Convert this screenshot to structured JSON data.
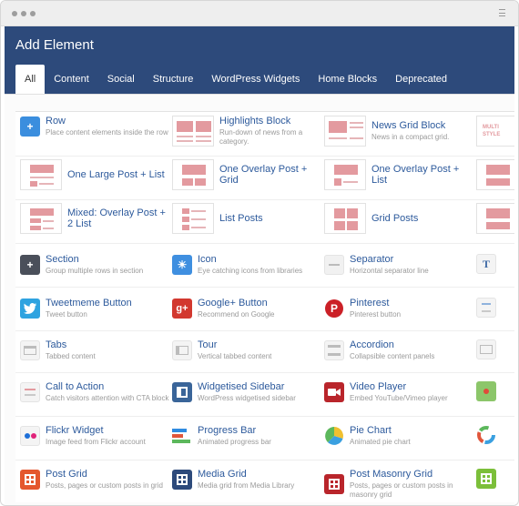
{
  "header": {
    "title": "Add Element"
  },
  "tabs": [
    {
      "label": "All",
      "active": true
    },
    {
      "label": "Content"
    },
    {
      "label": "Social"
    },
    {
      "label": "Structure"
    },
    {
      "label": "WordPress Widgets"
    },
    {
      "label": "Home Blocks"
    },
    {
      "label": "Deprecated"
    }
  ],
  "elements": {
    "row": {
      "title": "Row",
      "desc": "Place content elements inside the row"
    },
    "highlights_block": {
      "title": "Highlights Block",
      "desc": "Run-down of news from a category."
    },
    "news_grid_block": {
      "title": "News Grid Block",
      "desc": "News in a compact grid."
    },
    "multi_style": {
      "title": "MULTI STYLE"
    },
    "one_large_post_list": {
      "title": "One Large Post + List"
    },
    "one_overlay_post_grid": {
      "title": "One Overlay Post + Grid"
    },
    "one_overlay_post_list": {
      "title": "One Overlay Post + List"
    },
    "mixed_overlay_post_2_list": {
      "title": "Mixed: Overlay Post + 2 List"
    },
    "list_posts": {
      "title": "List Posts"
    },
    "grid_posts": {
      "title": "Grid Posts"
    },
    "section": {
      "title": "Section",
      "desc": "Group multiple rows in section"
    },
    "icon": {
      "title": "Icon",
      "desc": "Eye catching icons from libraries"
    },
    "separator": {
      "title": "Separator",
      "desc": "Horizontal separator line"
    },
    "tweetmeme_button": {
      "title": "Tweetmeme Button",
      "desc": "Tweet button"
    },
    "google_plus_button": {
      "title": "Google+ Button",
      "desc": "Recommend on Google"
    },
    "pinterest": {
      "title": "Pinterest",
      "desc": "Pinterest button"
    },
    "tabs": {
      "title": "Tabs",
      "desc": "Tabbed content"
    },
    "tour": {
      "title": "Tour",
      "desc": "Vertical tabbed content"
    },
    "accordion": {
      "title": "Accordion",
      "desc": "Collapsible content panels"
    },
    "call_to_action": {
      "title": "Call to Action",
      "desc": "Catch visitors attention with CTA block"
    },
    "widgetised_sidebar": {
      "title": "Widgetised Sidebar",
      "desc": "WordPress widgetised sidebar"
    },
    "video_player": {
      "title": "Video Player",
      "desc": "Embed YouTube/Vimeo player"
    },
    "flickr_widget": {
      "title": "Flickr Widget",
      "desc": "Image feed from Flickr account"
    },
    "progress_bar": {
      "title": "Progress Bar",
      "desc": "Animated progress bar"
    },
    "pie_chart": {
      "title": "Pie Chart",
      "desc": "Animated pie chart"
    },
    "post_grid": {
      "title": "Post Grid",
      "desc": "Posts, pages or custom posts in grid"
    },
    "media_grid": {
      "title": "Media Grid",
      "desc": "Media grid from Media Library"
    },
    "post_masonry_grid": {
      "title": "Post Masonry Grid",
      "desc": "Posts, pages or custom posts in masonry grid"
    }
  },
  "colors": {
    "header_bg": "#2d4a7b",
    "title_blue": "#2d5a9c",
    "thumb_red": "#e39a9f"
  }
}
